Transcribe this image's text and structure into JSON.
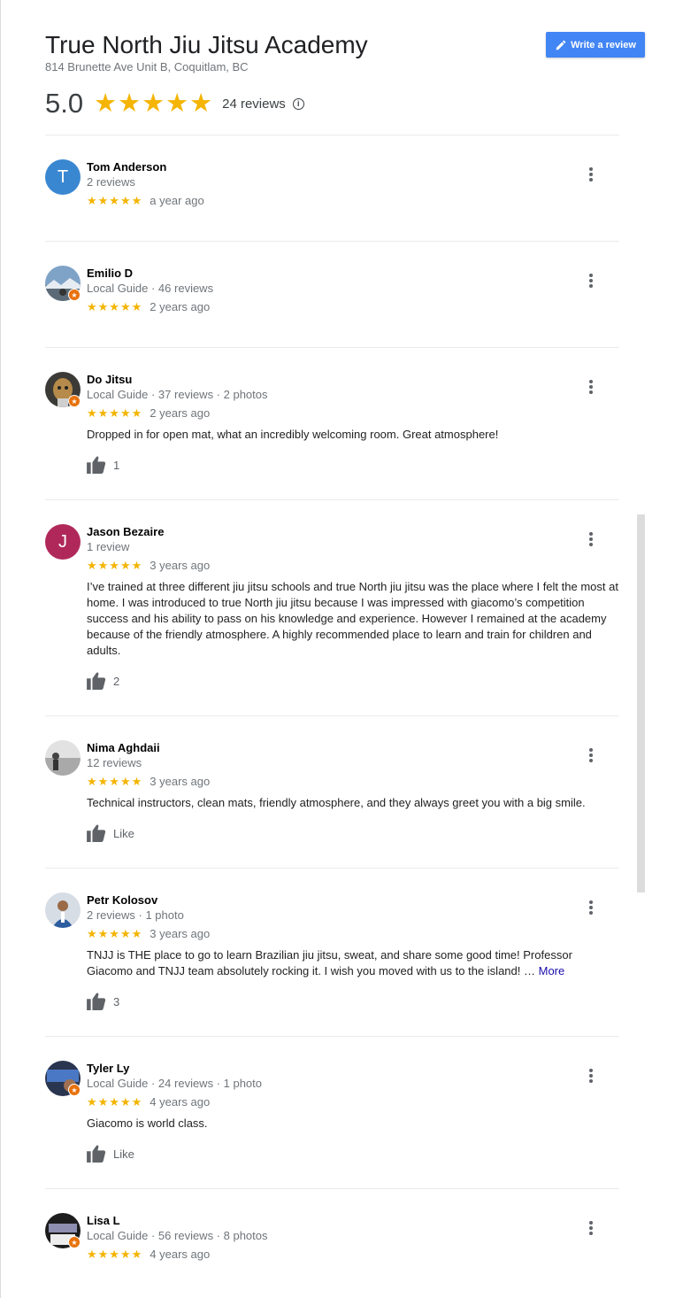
{
  "business": {
    "name": "True North Jiu Jitsu Academy",
    "address": "814 Brunette Ave Unit B, Coquitlam, BC",
    "rating": "5.0",
    "stars": "★★★★★",
    "review_count": "24 reviews",
    "info_glyph": "i"
  },
  "actions": {
    "write_review": "Write a review"
  },
  "colors": {
    "star": "#f4b400",
    "button": "#4285f4",
    "guide_badge": "#e8710a"
  },
  "reviews": [
    {
      "name": "Tom Anderson",
      "meta": "2 reviews",
      "stars": "★★★★★",
      "date": "a year ago",
      "text": "",
      "like": "",
      "avatar_letter": "T",
      "avatar_color": "#3a87d1",
      "local_guide": false
    },
    {
      "name": "Emilio D",
      "meta": "Local Guide · 46 reviews",
      "stars": "★★★★★",
      "date": "2 years ago",
      "text": "",
      "like": "",
      "avatar_letter": "",
      "avatar_color": "",
      "local_guide": true
    },
    {
      "name": "Do Jitsu",
      "meta": "Local Guide · 37 reviews · 2 photos",
      "stars": "★★★★★",
      "date": "2 years ago",
      "text": "Dropped in for open mat, what an incredibly welcoming room. Great atmosphere!",
      "like": "1",
      "avatar_letter": "",
      "avatar_color": "",
      "local_guide": true
    },
    {
      "name": "Jason Bezaire",
      "meta": "1 review",
      "stars": "★★★★★",
      "date": "3 years ago",
      "text": "I’ve trained at three different jiu jitsu schools and true North jiu jitsu was the place where I felt the most at home.  I was introduced to true North jiu jitsu because I was impressed with giacomo’s competition success and his ability to pass on his knowledge and experience.  However I remained at the academy because of the friendly atmosphere.  A highly recommended place to learn and train for children and adults.",
      "like": "2",
      "avatar_letter": "J",
      "avatar_color": "#b0285a",
      "local_guide": false
    },
    {
      "name": "Nima Aghdaii",
      "meta": "12 reviews",
      "stars": "★★★★★",
      "date": "3 years ago",
      "text": "Technical instructors, clean mats, friendly atmosphere, and they always greet you with a big smile.",
      "like": "Like",
      "avatar_letter": "",
      "avatar_color": "",
      "local_guide": false
    },
    {
      "name": "Petr Kolosov",
      "meta": "2 reviews · 1 photo",
      "stars": "★★★★★",
      "date": "3 years ago",
      "text": "TNJJ is THE place to go to learn Brazilian jiu jitsu, sweat, and share some good time! Professor Giacomo and TNJJ team absolutely rocking it. I wish you moved with us to the island! …",
      "more": "More",
      "like": "3",
      "avatar_letter": "",
      "avatar_color": "",
      "local_guide": false
    },
    {
      "name": "Tyler Ly",
      "meta": "Local Guide · 24 reviews · 1 photo",
      "stars": "★★★★★",
      "date": "4 years ago",
      "text": "Giacomo is world class.",
      "like": "Like",
      "avatar_letter": "",
      "avatar_color": "",
      "local_guide": true
    },
    {
      "name": "Lisa L",
      "meta": "Local Guide · 56 reviews · 8 photos",
      "stars": "★★★★★",
      "date": "4 years ago",
      "text": "",
      "like": "",
      "avatar_letter": "",
      "avatar_color": "",
      "local_guide": true
    }
  ]
}
